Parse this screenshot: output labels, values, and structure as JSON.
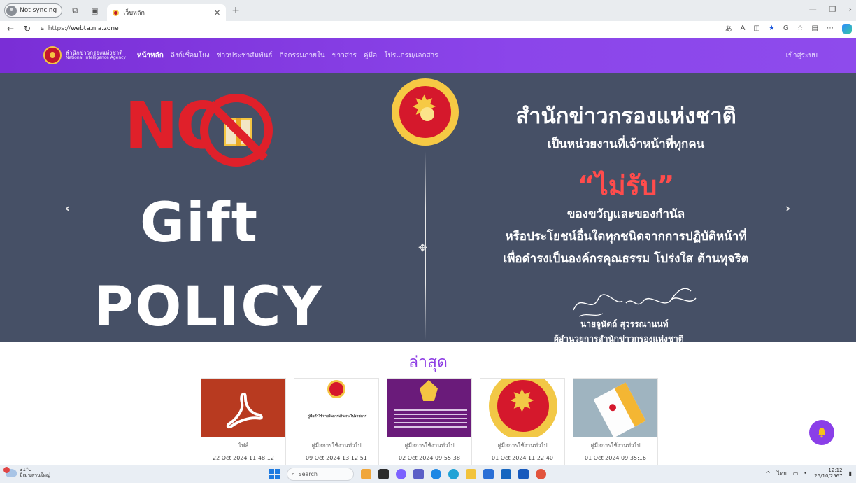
{
  "browser": {
    "profile_label": "Not syncing",
    "tab_title": "เว็บหลัก",
    "url_prefix": "https://",
    "url_host": "webta.nia.zone"
  },
  "site": {
    "org_name_th": "สำนักข่าวกรองแห่งชาติ",
    "org_name_en": "National Intelligence Agency",
    "nav": [
      {
        "label": "หน้าหลัก",
        "active": true
      },
      {
        "label": "ลิงก์เชื่อมโยง",
        "active": false
      },
      {
        "label": "ข่าวประชาสัมพันธ์",
        "active": false
      },
      {
        "label": "กิจกรรมภายใน",
        "active": false
      },
      {
        "label": "ข่าวสาร",
        "active": false
      },
      {
        "label": "คู่มือ",
        "active": false
      },
      {
        "label": "โปรแกรม/เอกสาร",
        "active": false
      }
    ],
    "login_label": "เข้าสู่ระบบ"
  },
  "hero": {
    "no_text": "NO",
    "gift_text": "Gift",
    "policy_text": "POLICY",
    "title": "สำนักข่าวกรองแห่งชาติ",
    "line2": "เป็นหน่วยงานที่เจ้าหน้าที่ทุกคน",
    "refuse": "“ไม่รับ”",
    "line3": "ของขวัญและของกำนัล",
    "line4": "หรือประโยชน์อื่นใดทุกชนิดจากการปฏิบัติหน้าที่",
    "line5": "เพื่อดำรงเป็นองค์กรคุณธรรม โปร่งใส ต้านทุจริต",
    "signer_name": "นายจูนัตถ์ สุวรรณานนท์",
    "signer_position": "ผู้อำนวยการสำนักข่าวกรองแห่งชาติ",
    "prev_icon": "chevron-left-icon",
    "next_icon": "chevron-right-icon"
  },
  "latest": {
    "heading": "ล่าสุด",
    "cards": [
      {
        "category": "ไฟล์",
        "date": "22 Oct 2024 11:48:12",
        "thumb": "pdf-icon"
      },
      {
        "category": "คู่มือการใช้งานทั่วไป",
        "date": "09 Oct 2024 13:12:51",
        "thumb": "manual-cover",
        "caption": "คู่มือคำใช้จ่ายในการเดินทางไปราชการ"
      },
      {
        "category": "คู่มือการใช้งานทั่วไป",
        "date": "02 Oct 2024 09:55:38",
        "thumb": "purple-document"
      },
      {
        "category": "คู่มือการใช้งานทั่วไป",
        "date": "01 Oct 2024 11:22:40",
        "thumb": "agency-seal"
      },
      {
        "category": "คู่มือการใช้งานทั่วไป",
        "date": "01 Oct 2024 09:35:16",
        "thumb": "book-in-hands"
      }
    ]
  },
  "taskbar": {
    "temperature": "31°C",
    "weather_desc": "มีเมฆส่วนใหญ่",
    "search_label": "Search",
    "lang": "ไทย",
    "time": "12:12",
    "date": "25/10/2567"
  },
  "colors": {
    "header_purple": "#8b45ea",
    "hero_bg": "#465066",
    "accent_red": "#e0202a",
    "heading_purple": "#8e3fe4"
  }
}
